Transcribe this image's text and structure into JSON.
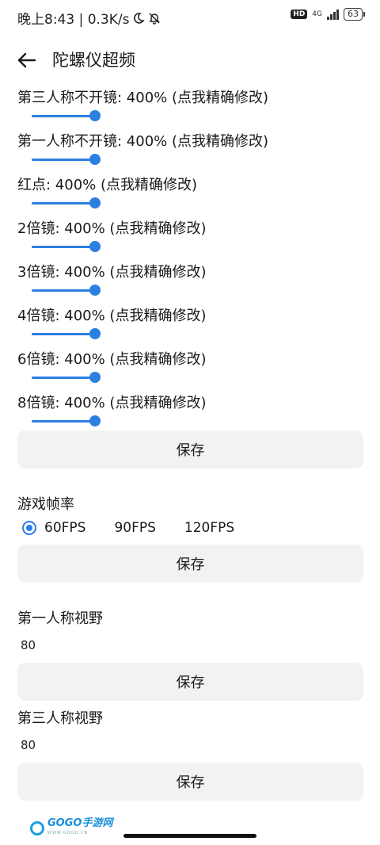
{
  "status_bar": {
    "time_text": "晚上8:43 | 0.3K/s",
    "hd_badge": "HD",
    "network": "4G",
    "battery": "63",
    "moon_icon": "moon-icon",
    "bell_icon": "bell-off-icon"
  },
  "header": {
    "back_icon": "arrow-left-icon",
    "title": "陀螺仪超频"
  },
  "sliders": [
    {
      "label": "第三人称不开镜: 400% (点我精确修改)",
      "value_percent": 400
    },
    {
      "label": "第一人称不开镜: 400% (点我精确修改)",
      "value_percent": 400
    },
    {
      "label": "红点: 400% (点我精确修改)",
      "value_percent": 400
    },
    {
      "label": "2倍镜: 400% (点我精确修改)",
      "value_percent": 400
    },
    {
      "label": "3倍镜: 400% (点我精确修改)",
      "value_percent": 400
    },
    {
      "label": "4倍镜: 400% (点我精确修改)",
      "value_percent": 400
    },
    {
      "label": "6倍镜: 400% (点我精确修改)",
      "value_percent": 400
    },
    {
      "label": "8倍镜: 400% (点我精确修改)",
      "value_percent": 400
    }
  ],
  "save_label": "保存",
  "frame_rate": {
    "label": "游戏帧率",
    "options": [
      "60FPS",
      "90FPS",
      "120FPS"
    ],
    "selected": "60FPS"
  },
  "first_person_fov": {
    "label": "第一人称视野",
    "value": "80"
  },
  "third_person_fov": {
    "label": "第三人称视野",
    "value": "80"
  },
  "watermark": {
    "logo_text": "GOGO手游网",
    "sub_text": "WWW.GOGO.CN"
  },
  "colors": {
    "accent": "#2b7fe0",
    "button_bg": "#f2f2f2"
  }
}
